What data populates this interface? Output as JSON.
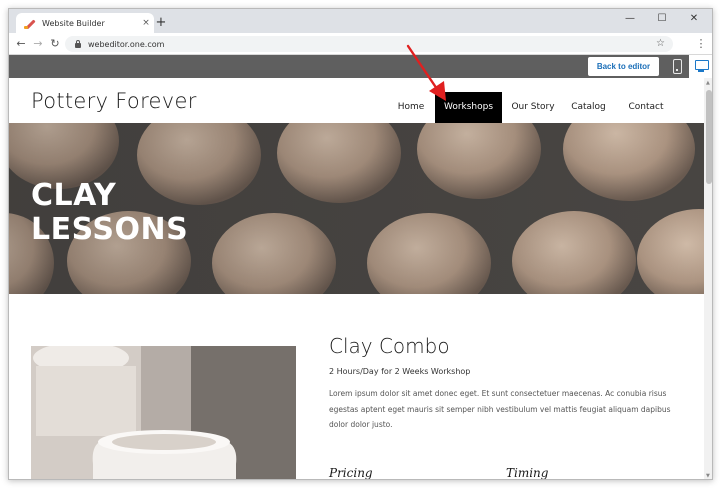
{
  "browser": {
    "tab_title": "Website Builder",
    "tab_close_icon": "×",
    "new_tab_icon": "+",
    "minimize_icon": "—",
    "maximize_icon": "☐",
    "close_icon": "✕",
    "back_icon": "←",
    "forward_icon": "→",
    "reload_icon": "↻",
    "url": "webeditor.one.com",
    "star_icon": "☆",
    "menu_icon": "⋮"
  },
  "editor": {
    "back_to_editor_label": "Back to editor",
    "accent_color": "#1b78c8"
  },
  "site": {
    "logo": "Pottery Forever",
    "nav": [
      {
        "label": "Home"
      },
      {
        "label": "Workshops"
      },
      {
        "label": "Our Story"
      },
      {
        "label": "Catalog"
      },
      {
        "label": "Contact"
      }
    ],
    "active_nav": "Workshops",
    "hero_title_line1": "CLAY",
    "hero_title_line2": "LESSONS",
    "product": {
      "title": "Clay Combo",
      "subtitle": "2 Hours/Day for 2 Weeks Workshop",
      "description": "Lorem ipsum dolor sit amet donec eget. Et sunt consectetuer maecenas. Ac conubia risus egestas aptent eget mauris sit semper nibh vestibulum vel mattis feugiat aliquam dapibus dolor dolor justo.",
      "pricing_label": "Pricing",
      "timing_label": "Timing"
    }
  },
  "annotation": {
    "arrow_color": "#e02020"
  }
}
